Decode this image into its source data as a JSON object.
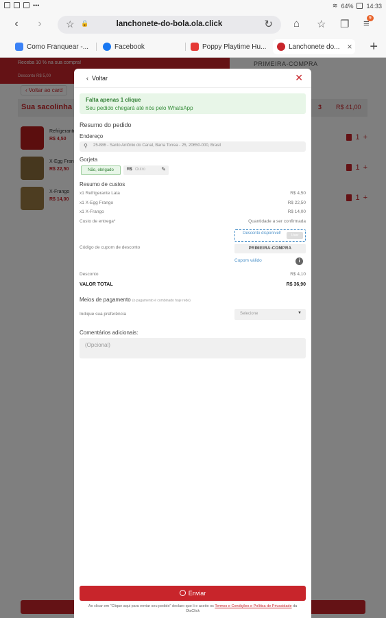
{
  "status": {
    "left_icons": [
      "photo-icon",
      "gallery-icon",
      "square-icon",
      "dots-icon"
    ],
    "battery": "64%",
    "time": "14:33"
  },
  "browser": {
    "url": "lanchonete-do-bola.ola.click",
    "menu_badge": "9",
    "tabs": [
      {
        "label": "Como Franquear -...",
        "favicon_color": "#3b82f6"
      },
      {
        "label": "Facebook",
        "favicon_color": "#1877f2"
      },
      {
        "label": "Poppy Playtime Hu...",
        "favicon_color": "#e53935"
      },
      {
        "label": "Lanchonete do...",
        "favicon_color": "#c8252b",
        "active": true
      }
    ]
  },
  "background": {
    "promo_line1": "Receba 10 % na sua compra!",
    "promo_line2": "Desconto R$ 5,00",
    "promo_code": "PRIMEIRA-COMPRA",
    "back_label": "Voltar ao card",
    "bag_title": "Sua sacolinha",
    "bag_count": "3",
    "bag_total": "R$ 41,00",
    "items": [
      {
        "name": "Refrigerante",
        "price": "R$ 4,50",
        "qty": "1",
        "thumb": "#b71c1c"
      },
      {
        "name": "X-Egg Frango",
        "price": "R$ 22,50",
        "qty": "1",
        "thumb": "#8d6e3c"
      },
      {
        "name": "X-Frango",
        "price": "R$ 14,00",
        "qty": "1",
        "thumb": "#9a7a42"
      }
    ]
  },
  "modal": {
    "back_label": "Voltar",
    "alert_title": "Falta apenas 1 clique",
    "alert_text": "Seu pedido chegará até nós pelo WhatsApp",
    "summary_title": "Resumo do pedido",
    "address_label": "Endereço",
    "address_value": "25-886 - Santo Antônio do Canal, Barra Torrea - 25, 20650-000, Brasil",
    "tip_label": "Gorjeta",
    "tip_none": "Não, obrigado",
    "tip_currency": "R$",
    "tip_placeholder": "Outro",
    "costs_title": "Resumo de custos",
    "cost_rows": [
      {
        "label": "x1 Refrigerante Lata",
        "value": "R$ 4,50"
      },
      {
        "label": "x1 X-Egg Frango",
        "value": "R$ 22,50"
      },
      {
        "label": "x1 X-Frango",
        "value": "R$ 14,00"
      }
    ],
    "delivery_label": "Custo de entrega*",
    "delivery_value": "Quantidade a ser confirmada",
    "coupon_available": "Desconto disponível!",
    "coupon_apply": "Usar",
    "coupon_label": "Código de cupom de desconto",
    "coupon_code": "PRIMEIRA-COMPRA",
    "coupon_valid": "Cupom válido",
    "discount_label": "Desconto",
    "discount_value": "R$ 4,10",
    "total_label": "VALOR TOTAL",
    "total_value": "R$ 36,90",
    "payment_title": "Meios de pagamento",
    "payment_note": "(o pagamento é combinado hoje rede)",
    "payment_prompt": "Indique sua preferência",
    "payment_select": "Selecione",
    "comments_title": "Comentários adicionais:",
    "comments_placeholder": "(Opcional)",
    "send_label": "Enviar",
    "terms_prefix": "Ao clicar em \"Clique aqui para enviar seu pedido\" declaro que li e aceito os",
    "terms_link": "Termos e Condições e Política de Privacidade",
    "terms_suffix": "da OlaClick"
  }
}
